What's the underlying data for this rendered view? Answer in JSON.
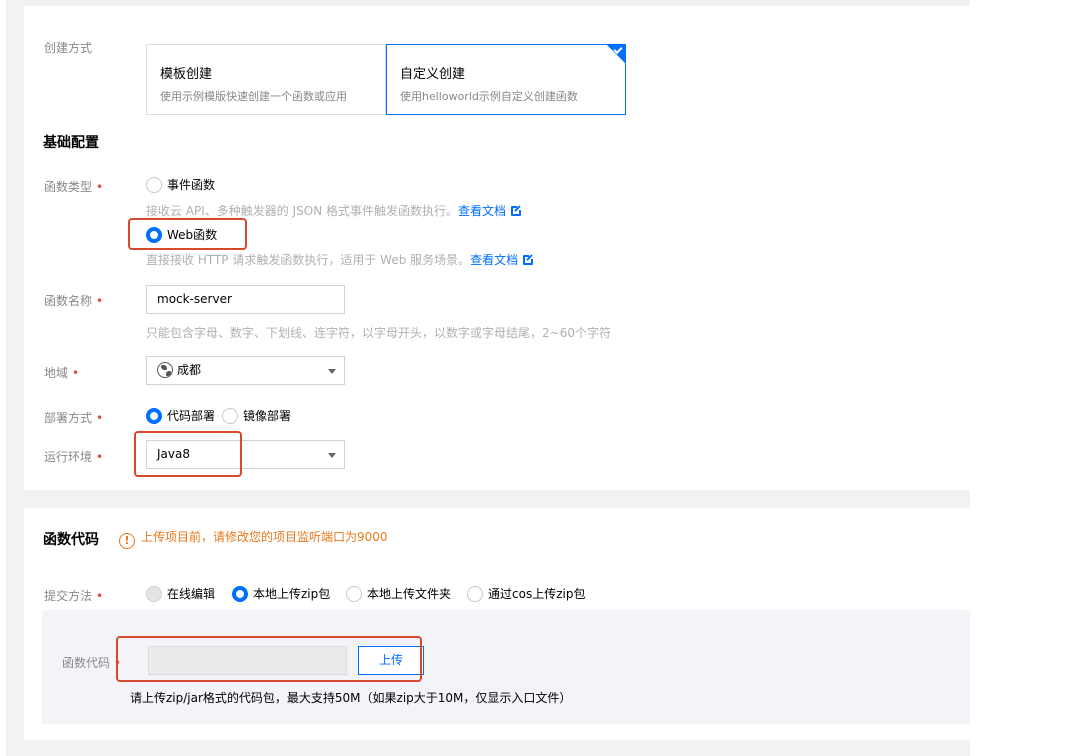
{
  "create_method": {
    "label": "创建方式",
    "options": [
      {
        "title": "模板创建",
        "desc": "使用示例模版快速创建一个函数或应用",
        "selected": false
      },
      {
        "title": "自定义创建",
        "desc": "使用helloworld示例自定义创建函数",
        "selected": true
      }
    ]
  },
  "basic_config": {
    "title": "基础配置",
    "function_type": {
      "label": "函数类型",
      "required_mark": "•",
      "event": {
        "label": "事件函数",
        "selected": false,
        "help": "接收云 API、多种触发器的 JSON 格式事件触发函数执行。",
        "doc_link": "查看文档"
      },
      "web": {
        "label": "Web函数",
        "selected": true,
        "help": "直接接收 HTTP 请求触发函数执行，适用于 Web 服务场景。",
        "doc_link": "查看文档"
      }
    },
    "function_name": {
      "label": "函数名称",
      "value": "mock-server",
      "help": "只能包含字母、数字、下划线、连字符，以字母开头，以数字或字母结尾，2~60个字符"
    },
    "region": {
      "label": "地域",
      "value": "成都",
      "icon": "globe-icon"
    },
    "deploy_method": {
      "label": "部署方式",
      "options": [
        {
          "label": "代码部署",
          "selected": true
        },
        {
          "label": "镜像部署",
          "selected": false
        }
      ]
    },
    "runtime": {
      "label": "运行环境",
      "value": "Java8"
    }
  },
  "function_code": {
    "title": "函数代码",
    "warning_icon": "!",
    "warning": "上传项目前，请修改您的项目监听端口为9000",
    "submit_method": {
      "label": "提交方法",
      "options": [
        {
          "label": "在线编辑",
          "selected": false,
          "disabled": true
        },
        {
          "label": "本地上传zip包",
          "selected": true,
          "disabled": false
        },
        {
          "label": "本地上传文件夹",
          "selected": false,
          "disabled": false
        },
        {
          "label": "通过cos上传zip包",
          "selected": false,
          "disabled": false
        }
      ]
    },
    "code": {
      "label": "函数代码",
      "upload_label": "上传",
      "help": "请上传zip/jar格式的代码包，最大支持50M（如果zip大于10M，仅显示入口文件）"
    }
  },
  "colors": {
    "accent": "#006eff",
    "required": "#e54545",
    "warning": "#e7791b",
    "highlight": "#d54a2e"
  }
}
